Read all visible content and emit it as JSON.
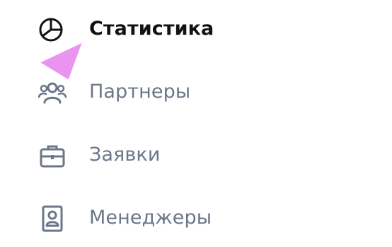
{
  "menu": {
    "items": [
      {
        "id": "stats",
        "label": "Статистика",
        "icon": "pie-chart-icon",
        "active": true
      },
      {
        "id": "partners",
        "label": "Партнеры",
        "icon": "users-icon",
        "active": false
      },
      {
        "id": "requests",
        "label": "Заявки",
        "icon": "briefcase-icon",
        "active": false
      },
      {
        "id": "managers",
        "label": "Менеджеры",
        "icon": "id-badge-icon",
        "active": false
      }
    ]
  },
  "colors": {
    "active_text": "#121212",
    "inactive_text": "#6b7689",
    "cursor": "#ea94f0"
  }
}
